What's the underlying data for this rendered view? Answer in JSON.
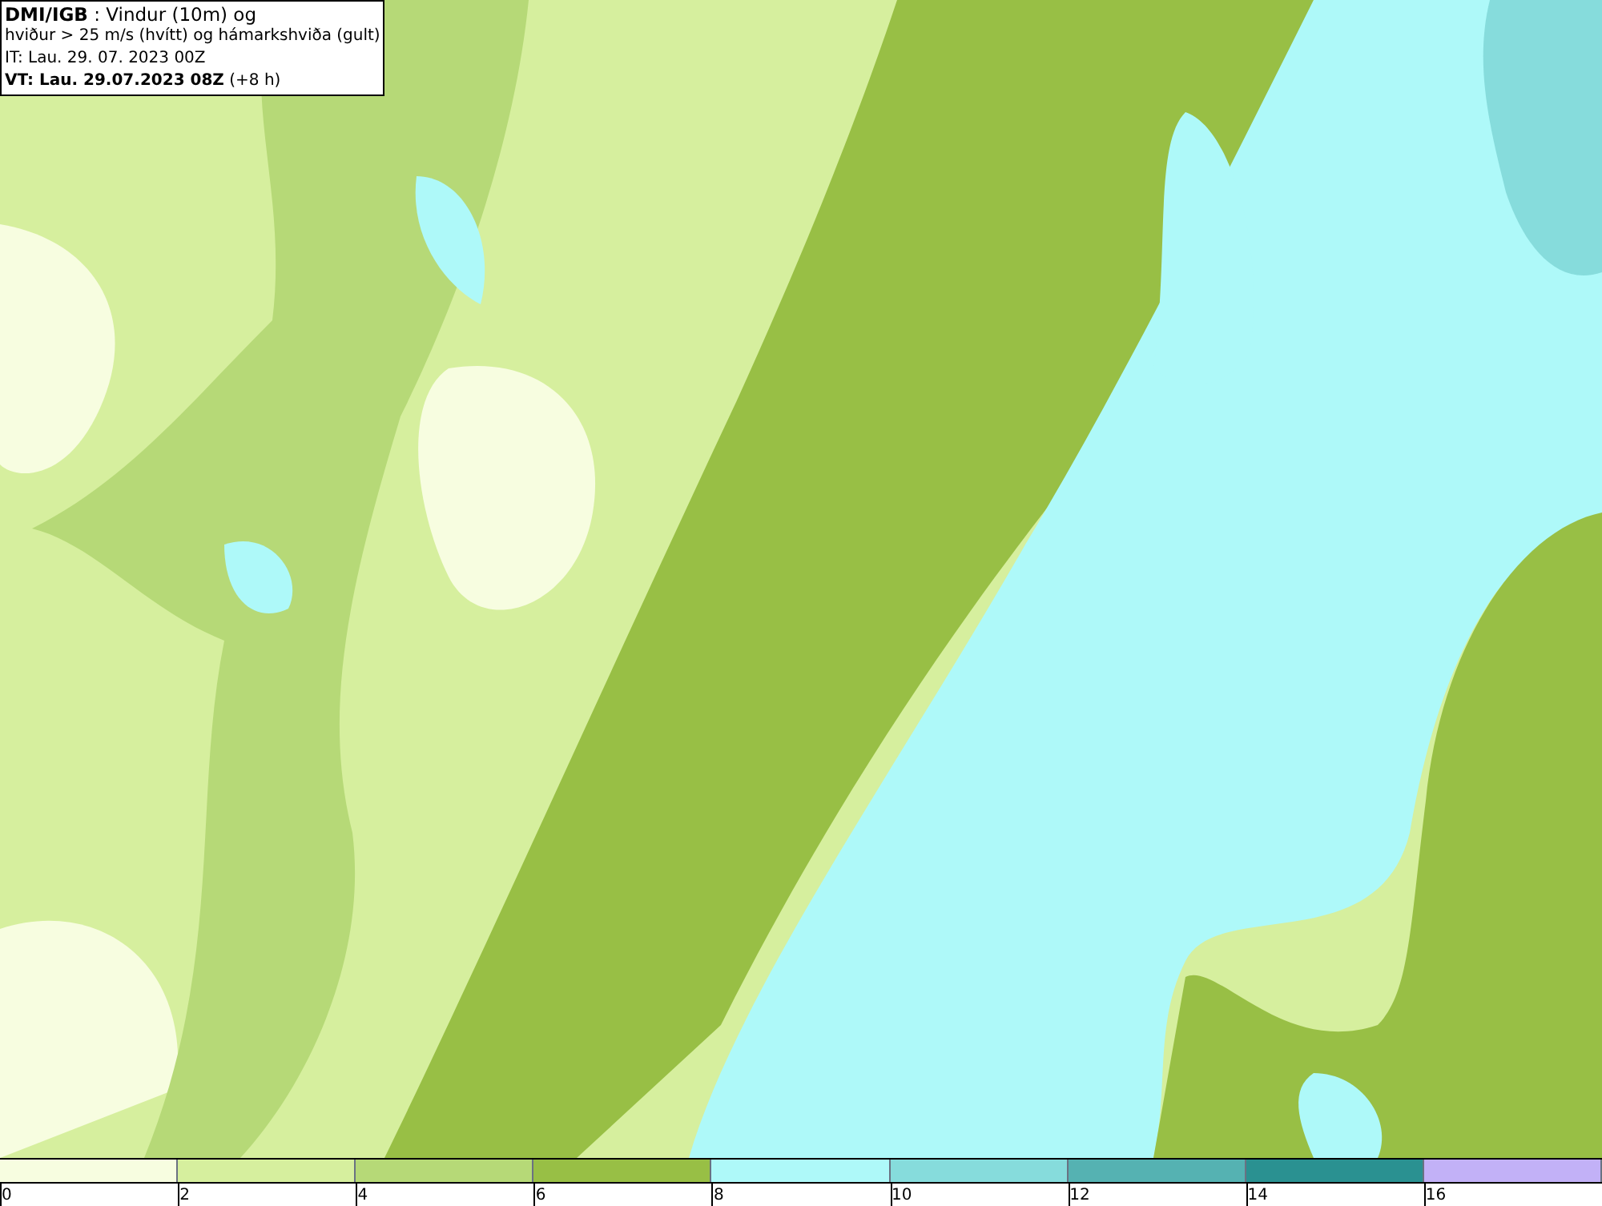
{
  "title_box": {
    "lines": [
      "**DMI/IGB** : Vindur (10m) og",
      "hviður > 25 m/s (hvítt) og hámarkshviða (gult)",
      "IT: Lau. 29. 07. 2023 00Z",
      "**VT: Lau. 29.07.2023 08Z** (+8 h)"
    ]
  },
  "legend": [
    {
      "label": "0",
      "color": "#f7fde0"
    },
    {
      "label": "2",
      "color": "#d6ef9e"
    },
    {
      "label": "4",
      "color": "#b6d977"
    },
    {
      "label": "6",
      "color": "#98bf45"
    },
    {
      "label": "8",
      "color": "#aef9f9"
    },
    {
      "label": "10",
      "color": "#86dcdc"
    },
    {
      "label": "12",
      "color": "#55b2b2"
    },
    {
      "label": "14",
      "color": "#2a9191"
    },
    {
      "label": "16",
      "color": "#c2b1f7"
    }
  ]
}
